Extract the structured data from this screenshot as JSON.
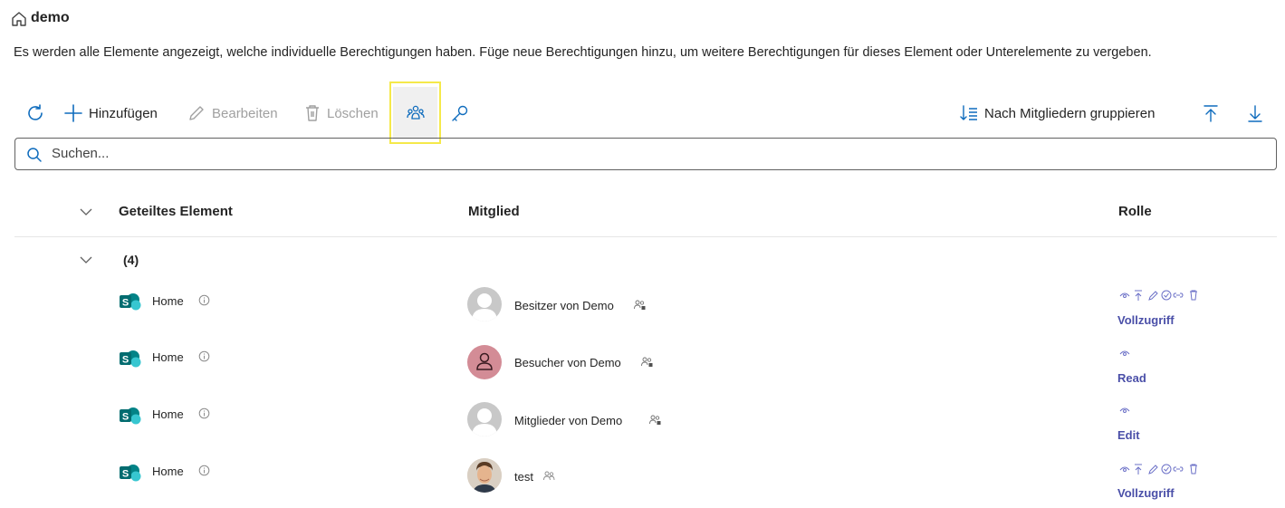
{
  "header": {
    "title": "demo",
    "icon": "home-icon"
  },
  "description": "Es werden alle Elemente angezeigt, welche individuelle Berechtigungen haben. Füge neue Berechtigungen hinzu, um weitere Berechtigungen für dieses Element oder Unterelemente zu vergeben.",
  "toolbar": {
    "add_label": "Hinzufügen",
    "edit_label": "Bearbeiten",
    "delete_label": "Löschen",
    "group_label": "Nach Mitgliedern gruppieren"
  },
  "search": {
    "placeholder": "Suchen..."
  },
  "table": {
    "columns": {
      "item": "Geteiltes Element",
      "member": "Mitglied",
      "role": "Rolle"
    },
    "group_count": "(4)",
    "rows": [
      {
        "item": "Home",
        "member": "Besitzer von Demo",
        "avatar": "default-avatar",
        "role": "Vollzugriff",
        "role_icons": [
          "view-icon",
          "arrow-up-icon",
          "pencil-icon",
          "check-circle-icon",
          "link-icon",
          "trash-icon"
        ]
      },
      {
        "item": "Home",
        "member": "Besucher von Demo",
        "avatar": "pink-person-avatar",
        "role": "Read",
        "role_icons": [
          "view-icon"
        ]
      },
      {
        "item": "Home",
        "member": "Mitglieder von Demo",
        "avatar": "default-avatar",
        "role": "Edit",
        "role_icons": [
          "view-icon"
        ]
      },
      {
        "item": "Home",
        "member": "test",
        "avatar": "photo-avatar",
        "role": "Vollzugriff",
        "role_icons": [
          "view-icon",
          "arrow-up-icon",
          "pencil-icon",
          "check-circle-icon",
          "link-icon",
          "trash-icon"
        ]
      }
    ]
  },
  "colors": {
    "accent": "#0f6cbd",
    "role": "#4a4fa8",
    "sharepoint": "#038387",
    "highlight": "#f5e94a"
  }
}
